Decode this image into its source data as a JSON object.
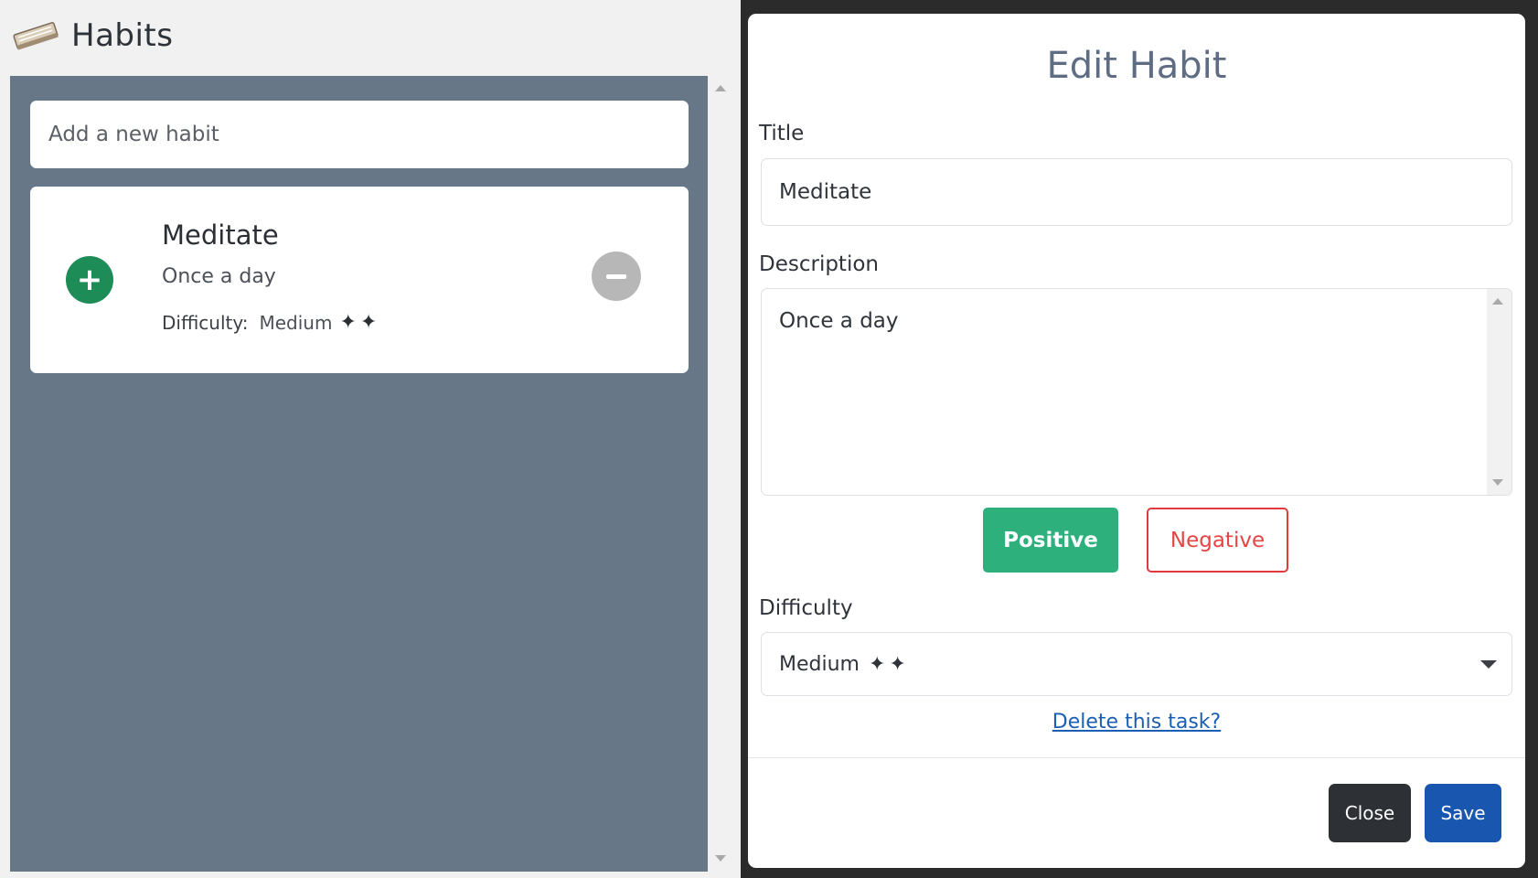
{
  "colors": {
    "habit_area_bg": "#687787",
    "positive_green": "#2eb07d",
    "plus_green": "#1e8c56",
    "negative_red": "#e03a3a",
    "save_blue": "#1956b0",
    "close_dark": "#2d3136",
    "link_blue": "#1a5fb4",
    "modal_title": "#5e6d84"
  },
  "habits_panel": {
    "title": "Habits",
    "icon": "book-icon",
    "new_habit_placeholder": "Add a new habit",
    "habits": [
      {
        "title": "Meditate",
        "description": "Once a day",
        "difficulty_label": "Difficulty:",
        "difficulty_value": "Medium",
        "difficulty_stars": "✦✦",
        "plus_icon": "plus-circle-icon",
        "minus_icon": "minus-circle-icon"
      }
    ]
  },
  "modal": {
    "title": "Edit Habit",
    "title_label": "Title",
    "title_value": "Meditate",
    "description_label": "Description",
    "description_value": "Once a day",
    "positive_label": "Positive",
    "negative_label": "Negative",
    "difficulty_label": "Difficulty",
    "difficulty_selected": "Medium",
    "difficulty_stars": "✦✦",
    "delete_link": "Delete this task?",
    "close_label": "Close",
    "save_label": "Save"
  }
}
